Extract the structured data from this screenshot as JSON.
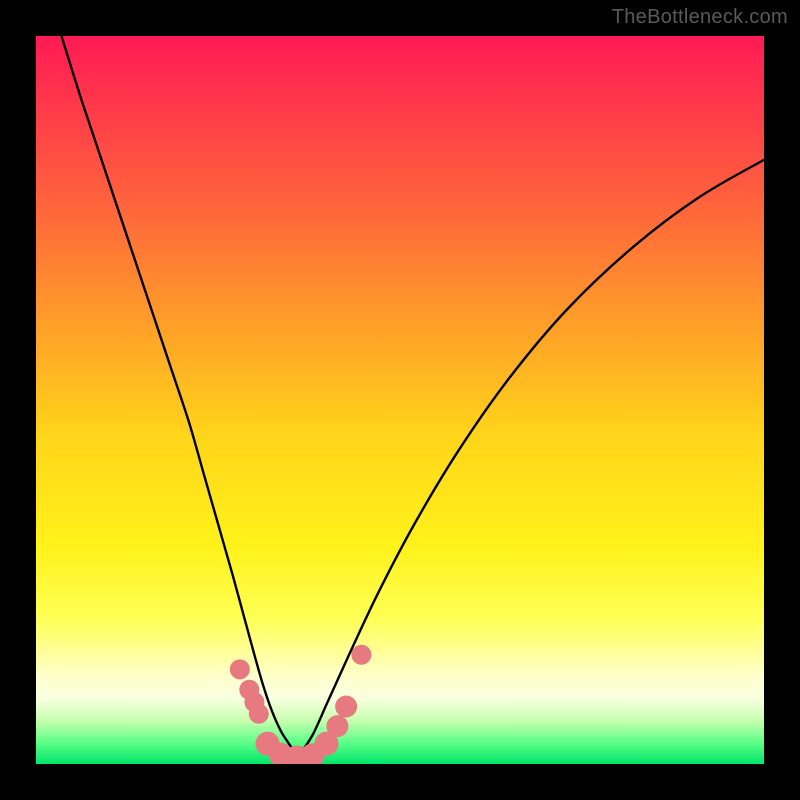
{
  "watermark": "TheBottleneck.com",
  "chart_data": {
    "type": "line",
    "title": "",
    "xlabel": "",
    "ylabel": "",
    "xlim": [
      0,
      1
    ],
    "ylim": [
      0,
      1
    ],
    "series": [
      {
        "name": "left-curve",
        "x": [
          0.035,
          0.06,
          0.085,
          0.11,
          0.135,
          0.16,
          0.185,
          0.21,
          0.23,
          0.25,
          0.27,
          0.285,
          0.3,
          0.312,
          0.324,
          0.336,
          0.348,
          0.36
        ],
        "y": [
          1.0,
          0.92,
          0.845,
          0.77,
          0.695,
          0.62,
          0.545,
          0.47,
          0.4,
          0.33,
          0.26,
          0.205,
          0.15,
          0.108,
          0.073,
          0.046,
          0.027,
          0.01
        ]
      },
      {
        "name": "right-curve",
        "x": [
          0.36,
          0.38,
          0.4,
          0.43,
          0.47,
          0.52,
          0.58,
          0.65,
          0.73,
          0.82,
          0.91,
          1.0
        ],
        "y": [
          0.01,
          0.04,
          0.084,
          0.15,
          0.235,
          0.33,
          0.43,
          0.53,
          0.625,
          0.71,
          0.778,
          0.83
        ]
      }
    ],
    "markers": {
      "name": "pink-dots",
      "color": "#e77a80",
      "points": [
        {
          "x": 0.28,
          "y": 0.13,
          "r": 10
        },
        {
          "x": 0.293,
          "y": 0.102,
          "r": 10
        },
        {
          "x": 0.3,
          "y": 0.085,
          "r": 10
        },
        {
          "x": 0.306,
          "y": 0.069,
          "r": 10
        },
        {
          "x": 0.318,
          "y": 0.028,
          "r": 12
        },
        {
          "x": 0.336,
          "y": 0.013,
          "r": 12
        },
        {
          "x": 0.358,
          "y": 0.009,
          "r": 12
        },
        {
          "x": 0.38,
          "y": 0.012,
          "r": 12
        },
        {
          "x": 0.399,
          "y": 0.028,
          "r": 12
        },
        {
          "x": 0.414,
          "y": 0.052,
          "r": 11
        },
        {
          "x": 0.426,
          "y": 0.079,
          "r": 11
        },
        {
          "x": 0.447,
          "y": 0.15,
          "r": 10
        }
      ]
    }
  }
}
